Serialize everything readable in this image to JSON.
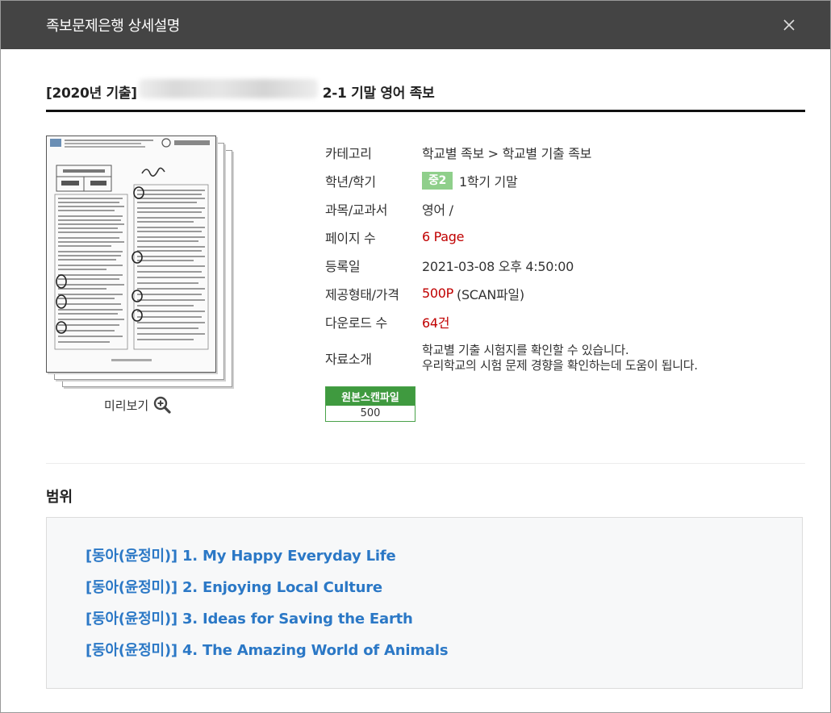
{
  "modal": {
    "title": "족보문제은행 상세설명",
    "close_icon": "close-icon"
  },
  "doc": {
    "title_prefix": "[2020년 기출]",
    "title_suffix": "2-1 기말 영어 족보"
  },
  "preview": {
    "label": "미리보기",
    "icon": "zoom-in-icon"
  },
  "info": {
    "category_label": "카테고리",
    "category_value": "학교별 족보 > 학교별 기출 족보",
    "grade_label": "학년/학기",
    "grade_badge": "중2",
    "grade_value": "1학기 기말",
    "subject_label": "과목/교과서",
    "subject_value": "영어 /",
    "pages_label": "페이지 수",
    "pages_value": "6 Page",
    "date_label": "등록일",
    "date_value": "2021-03-08 오후 4:50:00",
    "price_label": "제공형태/가격",
    "price_value": "500P",
    "price_note": "(SCAN파일)",
    "downloads_label": "다운로드 수",
    "downloads_value": "64건",
    "desc_label": "자료소개",
    "desc_line1": "학교별 기출 시험지를 확인할 수 있습니다.",
    "desc_line2": "우리학교의 시험 문제 경향을 확인하는데 도움이 됩니다."
  },
  "scan_button": {
    "label": "원본스캔파일",
    "price": "500"
  },
  "range": {
    "heading": "범위",
    "items": [
      "[동아(윤정미)] 1. My Happy Everyday Life",
      "[동아(윤정미)] 2. Enjoying Local Culture",
      "[동아(윤정미)] 3. Ideas for Saving the Earth",
      "[동아(윤정미)] 4. The Amazing World of Animals"
    ]
  },
  "colors": {
    "header_bg": "#444444",
    "badge_green": "#8fcf8b",
    "scan_green": "#3f9a3f",
    "accent_red": "#c00000",
    "link_blue": "#2b78c6"
  }
}
